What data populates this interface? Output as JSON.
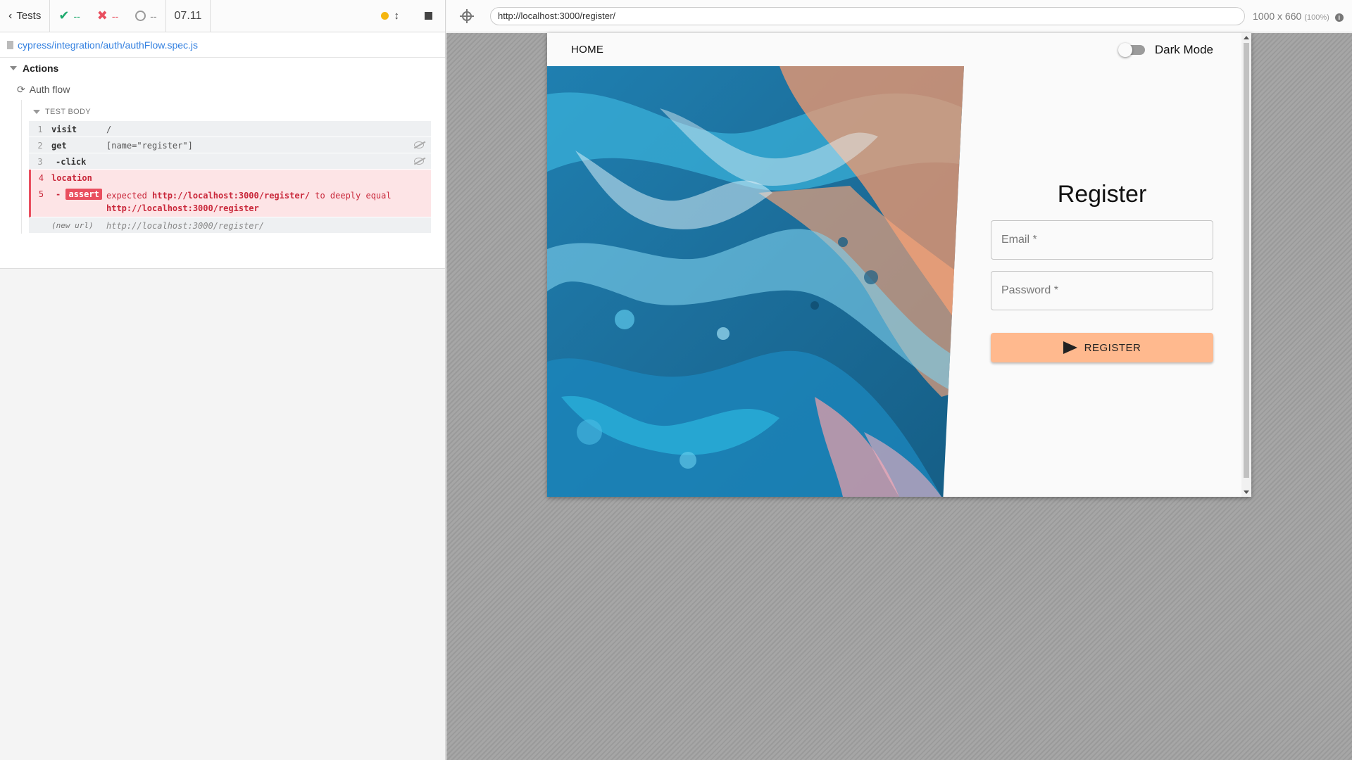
{
  "reporter": {
    "tests_label": "Tests",
    "passed": "--",
    "failed": "--",
    "pending": "--",
    "duration": "07.11",
    "spec_path": "cypress/integration/auth/authFlow.spec.js",
    "suite": "Actions",
    "test": "Auth flow",
    "test_body_label": "TEST BODY",
    "commands": [
      {
        "num": "1",
        "name": "visit",
        "msg": "/"
      },
      {
        "num": "2",
        "name": "get",
        "msg": "[name=\"register\"]"
      },
      {
        "num": "3",
        "name": "-click",
        "msg": ""
      },
      {
        "num": "4",
        "name": "location",
        "msg": ""
      },
      {
        "num": "5",
        "name": "-",
        "badge": "assert",
        "msg_prefix": "expected",
        "expected": "http://localhost:3000/register/",
        "mid": "to deeply equal",
        "actual": "http://localhost:3000/register"
      },
      {
        "num": "",
        "name": "(new url)",
        "msg": "http://localhost:3000/register/"
      }
    ],
    "colors": {
      "pass": "#1eaa6e",
      "fail": "#e94f5f",
      "running": "#f5b60f"
    }
  },
  "aut": {
    "url": "http://localhost:3000/register/",
    "viewport": "1000 x 660",
    "zoom": "(100%)"
  },
  "app": {
    "nav_home": "HOME",
    "dark_mode_label": "Dark Mode",
    "dark_mode_on": false,
    "title": "Register",
    "email_placeholder": "Email *",
    "password_placeholder": "Password *",
    "register_button": "REGISTER",
    "accent": "#ffb98e"
  }
}
